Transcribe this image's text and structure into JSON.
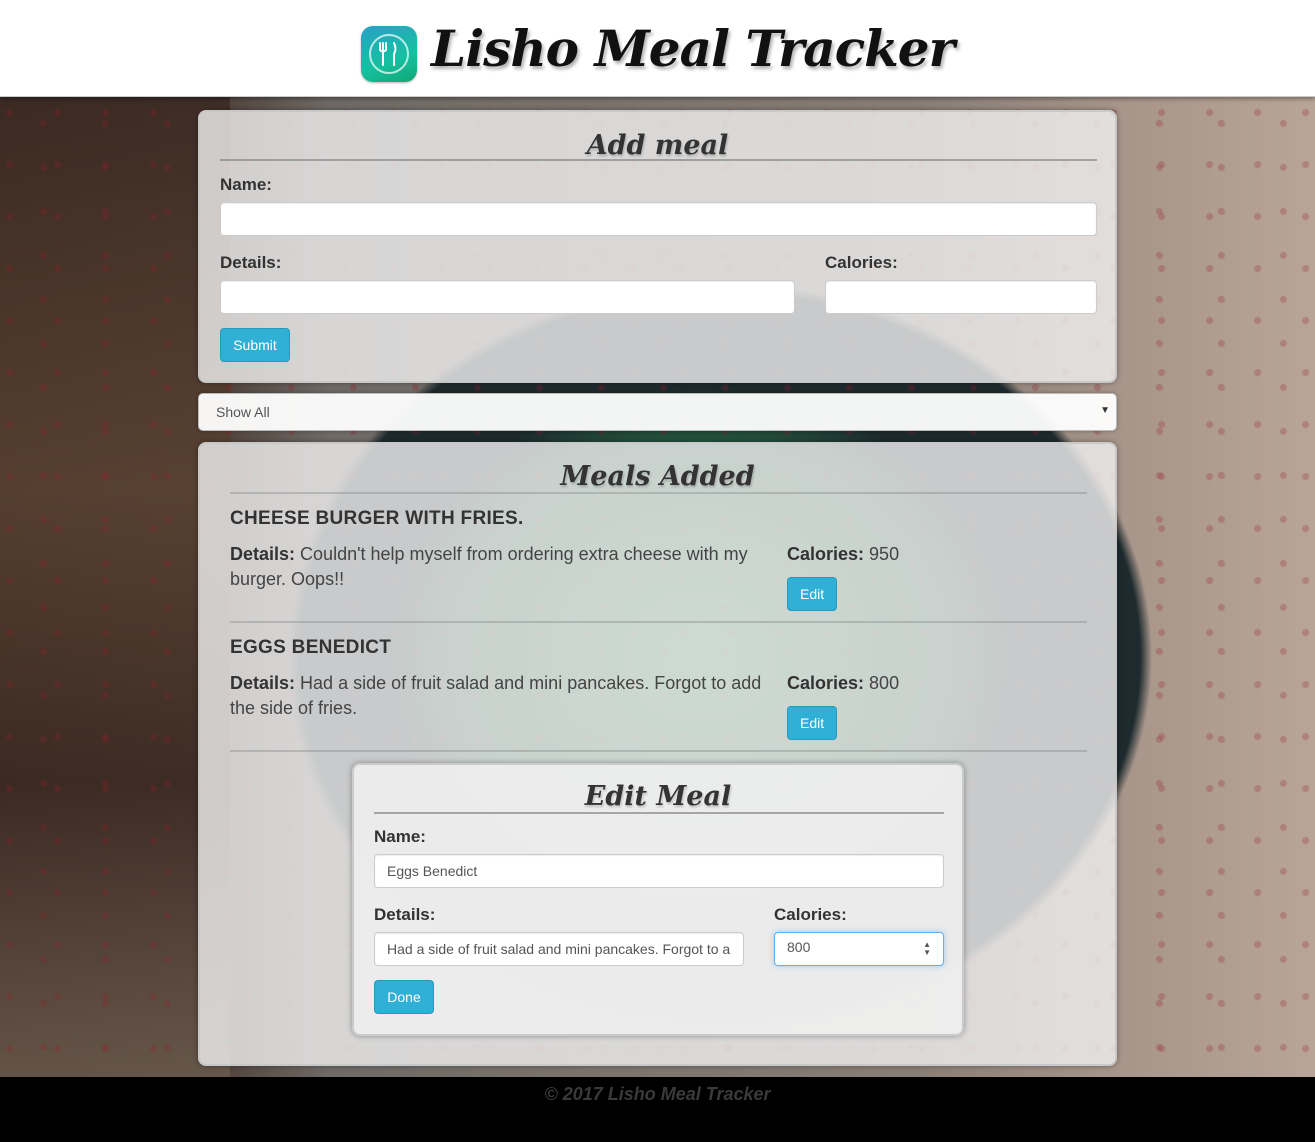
{
  "header": {
    "title": "Lisho Meal Tracker",
    "logo_icon": "fork-knife-icon"
  },
  "add_meal": {
    "heading": "Add meal",
    "name_label": "Name:",
    "name_value": "",
    "details_label": "Details:",
    "details_value": "",
    "calories_label": "Calories:",
    "calories_value": "",
    "submit_label": "Submit"
  },
  "filter": {
    "selected": "Show All"
  },
  "meals_added": {
    "heading": "Meals Added",
    "details_prefix": "Details:",
    "calories_prefix": "Calories:",
    "edit_label": "Edit",
    "items": [
      {
        "name": "CHEESE BURGER WITH FRIES.",
        "details": "Couldn't help myself from ordering extra cheese with my burger. Oops!!",
        "calories": "950"
      },
      {
        "name": "EGGS BENEDICT",
        "details": "Had a side of fruit salad and mini pancakes. Forgot to add the side of fries.",
        "calories": "800"
      }
    ]
  },
  "edit_meal": {
    "heading": "Edit Meal",
    "name_label": "Name:",
    "name_value": "Eggs Benedict",
    "details_label": "Details:",
    "details_value": "Had a side of fruit salad and mini pancakes. Forgot to a",
    "calories_label": "Calories:",
    "calories_value": "800",
    "done_label": "Done"
  },
  "footer": {
    "text": "© 2017 Lisho Meal Tracker"
  },
  "colors": {
    "button": "#31b0d5",
    "focus_border": "#66afe9"
  }
}
